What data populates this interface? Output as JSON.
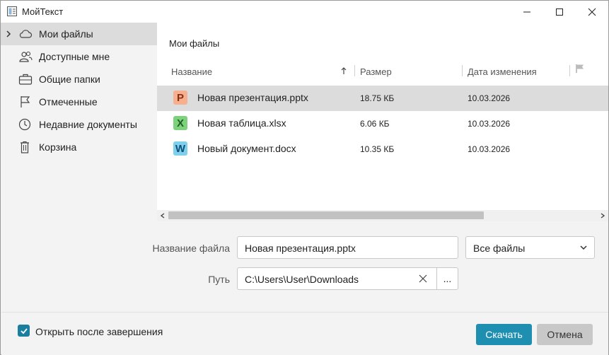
{
  "window": {
    "title": "МойТекст"
  },
  "sidebar": {
    "items": [
      {
        "label": "Мои файлы",
        "icon": "cloud-icon",
        "active": true
      },
      {
        "label": "Доступные мне",
        "icon": "users-icon"
      },
      {
        "label": "Общие папки",
        "icon": "briefcase-icon"
      },
      {
        "label": "Отмеченные",
        "icon": "flag-icon"
      },
      {
        "label": "Недавние документы",
        "icon": "clock-icon"
      },
      {
        "label": "Корзина",
        "icon": "trash-icon"
      }
    ]
  },
  "main": {
    "title": "Мои файлы",
    "columns": {
      "name": "Название",
      "size": "Размер",
      "date": "Дата изменения"
    },
    "files": [
      {
        "badge": "P",
        "badge_color": "#f3a27e",
        "badge_text_color": "#8a2e12",
        "name": "Новая презентация.pptx",
        "size": "18.75 КБ",
        "date": "10.03.2026",
        "selected": true
      },
      {
        "badge": "X",
        "badge_color": "#7ed17c",
        "badge_text_color": "#1b5e20",
        "name": "Новая таблица.xlsx",
        "size": "6.06 КБ",
        "date": "10.03.2026"
      },
      {
        "badge": "W",
        "badge_color": "#7fd0ea",
        "badge_text_color": "#0d4f7a",
        "name": "Новый документ.docx",
        "size": "10.35 КБ",
        "date": "10.03.2026"
      }
    ]
  },
  "form": {
    "filename_label": "Название файла",
    "filename_value": "Новая презентация.pptx",
    "filetype_value": "Все файлы",
    "path_label": "Путь",
    "path_value": "C:\\Users\\User\\Downloads",
    "browse_label": "..."
  },
  "footer": {
    "open_after_label": "Открыть после завершения",
    "open_after_checked": true,
    "download_label": "Скачать",
    "cancel_label": "Отмена"
  },
  "colors": {
    "accent": "#1e8fb0",
    "selection": "#dcdcdc"
  }
}
